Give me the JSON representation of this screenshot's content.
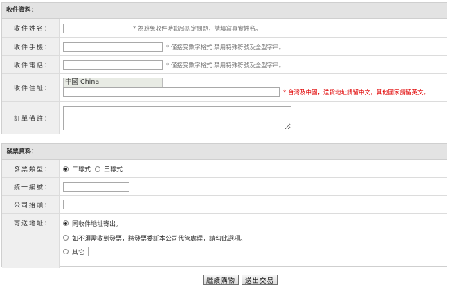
{
  "recipient": {
    "header": "收件資料：",
    "name_label": "收件姓名：",
    "name_hint": "* 為避免收件時郵局認定問題，請填寫真實姓名。",
    "mobile_label": "收件手機：",
    "mobile_hint": "* 僅接受數字格式,禁用特殊符號及全型字串。",
    "phone_label": "收件電話：",
    "phone_hint": "* 僅接受數字格式,禁用特殊符號及全型字串。",
    "address_label": "收件住址：",
    "country_value": "中國 China",
    "address_hint": "* 台灣及中國，送貨地址請留中文，其他國家請留英文。",
    "note_label": "訂單備註："
  },
  "invoice": {
    "header": "發票資料：",
    "type_label": "發票類型：",
    "type_opt1": "二聯式",
    "type_opt2": "三聯式",
    "taxid_label": "統一編號：",
    "company_label": "公司抬頭：",
    "mail_label": "寄送地址：",
    "mail_opt1": "同收件地址寄出。",
    "mail_opt2": "如不須需收到發票，將發票委託本公司代管處理，請勾此選項。",
    "mail_opt3": "其它"
  },
  "buttons": {
    "continue": "繼續購物",
    "submit": "送出交易"
  }
}
